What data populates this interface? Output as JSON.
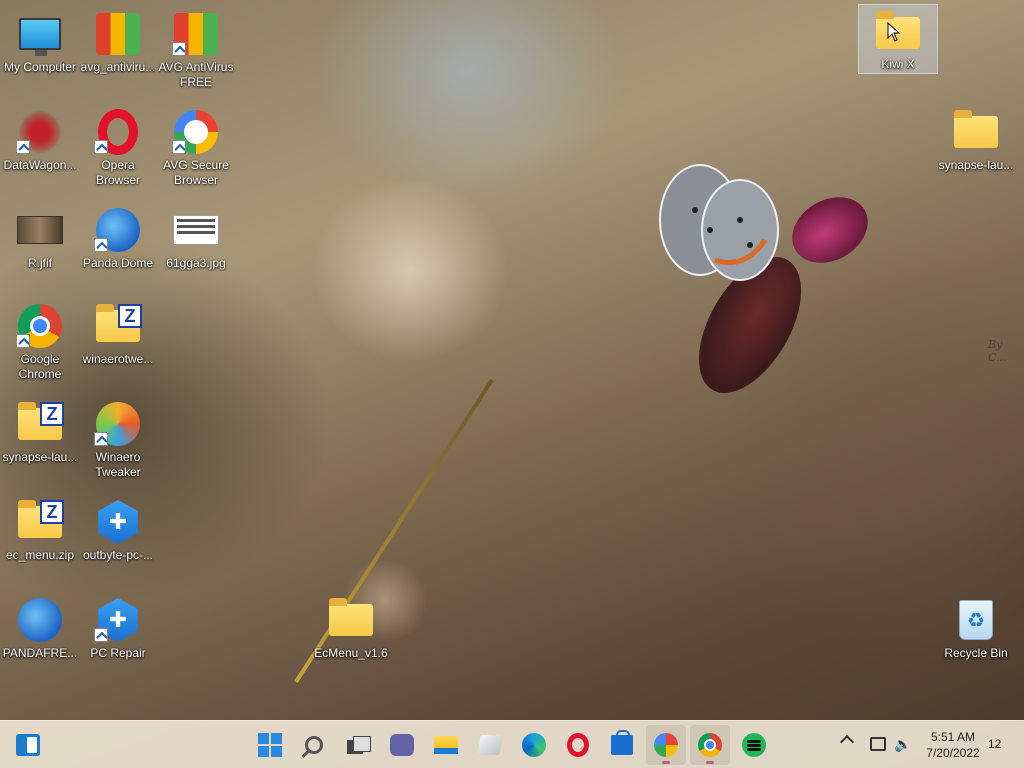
{
  "desktop": {
    "icons": [
      {
        "label": "My Computer",
        "icon": "computer-icon"
      },
      {
        "label": "avg_antiviru...",
        "icon": "installer-box-icon"
      },
      {
        "label": "AVG AntiVirus FREE",
        "icon": "avg-antivirus-icon"
      },
      {
        "label": "DataWagon...",
        "icon": "datawagon-icon"
      },
      {
        "label": "Opera Browser",
        "icon": "opera-icon"
      },
      {
        "label": "AVG Secure Browser",
        "icon": "avg-secure-browser-icon"
      },
      {
        "label": "R.jfif",
        "icon": "photo-thumbnail-icon"
      },
      {
        "label": "Panda Dome",
        "icon": "panda-dome-icon"
      },
      {
        "label": "61gga3.jpg",
        "icon": "document-image-icon"
      },
      {
        "label": "Google Chrome",
        "icon": "chrome-icon"
      },
      {
        "label": "winaerotwe...",
        "icon": "zip-folder-icon"
      },
      {
        "label": "synapse-lau...",
        "icon": "zip-folder-icon"
      },
      {
        "label": "Winaero Tweaker",
        "icon": "winaero-icon"
      },
      {
        "label": "ec_menu.zip",
        "icon": "zip-folder-icon"
      },
      {
        "label": "outbyte-pc-...",
        "icon": "pc-repair-icon"
      },
      {
        "label": "PANDAFRE...",
        "icon": "panda-installer-icon"
      },
      {
        "label": "PC Repair",
        "icon": "pc-repair-icon"
      },
      {
        "label": "EcMenu_v1.6",
        "icon": "folder-icon"
      },
      {
        "label": "Kiwi X",
        "icon": "folder-icon"
      },
      {
        "label": "synapse-lau...",
        "icon": "folder-icon"
      },
      {
        "label": "Recycle Bin",
        "icon": "recycle-bin-icon"
      }
    ],
    "wallpaper_signature": "By C..."
  },
  "taskbar": {
    "items": [
      {
        "name": "widgets",
        "icon": "widgets-icon"
      },
      {
        "name": "start",
        "icon": "windows-logo-icon"
      },
      {
        "name": "search",
        "icon": "search-icon"
      },
      {
        "name": "task-view",
        "icon": "task-view-icon"
      },
      {
        "name": "teams-chat",
        "icon": "teams-icon"
      },
      {
        "name": "file-explorer",
        "icon": "folder-icon"
      },
      {
        "name": "notepad",
        "icon": "notepad-icon"
      },
      {
        "name": "edge",
        "icon": "edge-icon"
      },
      {
        "name": "opera",
        "icon": "opera-icon"
      },
      {
        "name": "microsoft-store",
        "icon": "store-icon"
      },
      {
        "name": "avg-secure-browser",
        "icon": "avg-secure-browser-icon"
      },
      {
        "name": "chrome",
        "icon": "chrome-icon"
      },
      {
        "name": "spotify",
        "icon": "spotify-icon"
      }
    ],
    "tray": {
      "time": "5:51 AM",
      "date": "7/20/2022",
      "notification_count": "12"
    }
  }
}
